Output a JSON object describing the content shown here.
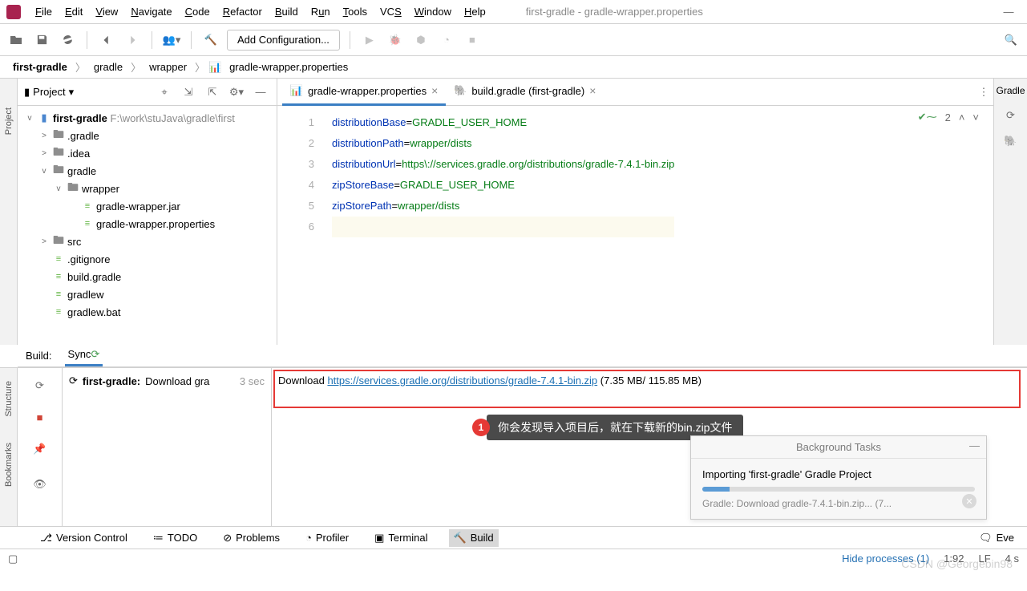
{
  "menubar": {
    "items": [
      "File",
      "Edit",
      "View",
      "Navigate",
      "Code",
      "Refactor",
      "Build",
      "Run",
      "Tools",
      "VCS",
      "Window",
      "Help"
    ],
    "title": "first-gradle - gradle-wrapper.properties"
  },
  "toolbar": {
    "config_label": "Add Configuration..."
  },
  "breadcrumb": [
    "first-gradle",
    "gradle",
    "wrapper",
    "gradle-wrapper.properties"
  ],
  "project": {
    "title": "Project",
    "root_name": "first-gradle",
    "root_path": "F:\\work\\stuJava\\gradle\\first",
    "nodes": [
      {
        "indent": 1,
        "tw": ">",
        "icon": "folder",
        "label": ".gradle"
      },
      {
        "indent": 1,
        "tw": ">",
        "icon": "folder",
        "label": ".idea"
      },
      {
        "indent": 1,
        "tw": "v",
        "icon": "folder",
        "label": "gradle"
      },
      {
        "indent": 2,
        "tw": "v",
        "icon": "folder",
        "label": "wrapper"
      },
      {
        "indent": 3,
        "tw": "",
        "icon": "file",
        "label": "gradle-wrapper.jar"
      },
      {
        "indent": 3,
        "tw": "",
        "icon": "file",
        "label": "gradle-wrapper.properties"
      },
      {
        "indent": 1,
        "tw": ">",
        "icon": "folder",
        "label": "src"
      },
      {
        "indent": 1,
        "tw": "",
        "icon": "file",
        "label": ".gitignore"
      },
      {
        "indent": 1,
        "tw": "",
        "icon": "file",
        "label": "build.gradle"
      },
      {
        "indent": 1,
        "tw": "",
        "icon": "file",
        "label": "gradlew"
      },
      {
        "indent": 1,
        "tw": "",
        "icon": "file",
        "label": "gradlew.bat"
      }
    ]
  },
  "editor": {
    "tabs": [
      {
        "label": "gradle-wrapper.properties",
        "active": true
      },
      {
        "label": "build.gradle (first-gradle)",
        "active": false
      }
    ],
    "badge_count": "2",
    "lines": [
      {
        "k": "distributionBase",
        "v": "GRADLE_USER_HOME"
      },
      {
        "k": "distributionPath",
        "v": "wrapper/dists"
      },
      {
        "k": "distributionUrl",
        "v": "https\\://services.gradle.org/distributions/gradle-7.4.1-bin.zip"
      },
      {
        "k": "zipStoreBase",
        "v": "GRADLE_USER_HOME"
      },
      {
        "k": "zipStorePath",
        "v": "wrapper/dists"
      }
    ]
  },
  "build": {
    "header_label": "Build:",
    "tab_label": "Sync",
    "task_name": "first-gradle:",
    "task_action": "Download gra",
    "task_time": "3 sec",
    "output_prefix": "Download ",
    "output_url": "https://services.gradle.org/distributions/gradle-7.4.1-bin.zip",
    "output_size": " (7.35 MB/ 115.85 MB)",
    "annotation_num": "1",
    "annotation_text": "你会发现导入项目后，就在下载新的bin.zip文件"
  },
  "bgtasks": {
    "title": "Background Tasks",
    "task": "Importing 'first-gradle' Gradle Project",
    "subtitle": "Gradle: Download gradle-7.4.1-bin.zip...  (7..."
  },
  "toolwindows": [
    "Version Control",
    "TODO",
    "Problems",
    "Profiler",
    "Terminal",
    "Build"
  ],
  "right_tool": "Eve",
  "status": {
    "hide": "Hide processes (1)",
    "pos": "1:92",
    "enc": "LF",
    "dur": "4 s"
  },
  "sidebars": {
    "left_top": "Project",
    "left_mid": "Structure",
    "left_bot": "Bookmarks",
    "right": "Gradle"
  },
  "watermark": "CSDN @Georgebin98"
}
